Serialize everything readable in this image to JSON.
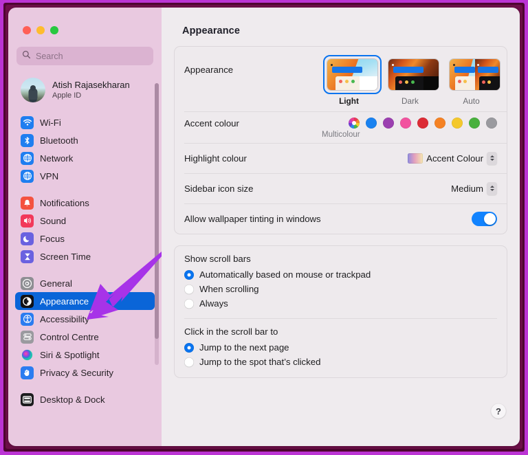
{
  "window": {
    "traffic_lights": [
      "close",
      "minimise",
      "maximise"
    ],
    "pane_title": "Appearance"
  },
  "sidebar": {
    "search": {
      "placeholder": "Search",
      "value": "",
      "icon": "search-icon"
    },
    "account": {
      "name": "Atish Rajasekharan",
      "subtitle": "Apple ID",
      "avatar": "user-avatar"
    },
    "groups": [
      {
        "items": [
          {
            "label": "Wi-Fi",
            "icon": "wifi-icon",
            "color": "#1f7ef0",
            "selected": false
          },
          {
            "label": "Bluetooth",
            "icon": "bluetooth-icon",
            "color": "#1f7ef0",
            "selected": false
          },
          {
            "label": "Network",
            "icon": "network-globe-icon",
            "color": "#1f7ef0",
            "selected": false
          },
          {
            "label": "VPN",
            "icon": "vpn-globe-icon",
            "color": "#1f7ef0",
            "selected": false
          }
        ]
      },
      {
        "items": [
          {
            "label": "Notifications",
            "icon": "bell-icon",
            "color": "#f4523f",
            "selected": false
          },
          {
            "label": "Sound",
            "icon": "speaker-icon",
            "color": "#f2385a",
            "selected": false
          },
          {
            "label": "Focus",
            "icon": "moon-icon",
            "color": "#6a61e0",
            "selected": false
          },
          {
            "label": "Screen Time",
            "icon": "hourglass-icon",
            "color": "#6a61e0",
            "selected": false
          }
        ]
      },
      {
        "items": [
          {
            "label": "General",
            "icon": "gear-icon",
            "color": "#8e8e93",
            "selected": false
          },
          {
            "label": "Appearance",
            "icon": "appearance-icon",
            "color": "#1c1c1e",
            "selected": true
          },
          {
            "label": "Accessibility",
            "icon": "accessibility-icon",
            "color": "#2b7cf0",
            "selected": false
          },
          {
            "label": "Control Centre",
            "icon": "control-centre-icon",
            "color": "#9a9a9f",
            "selected": false
          },
          {
            "label": "Siri & Spotlight",
            "icon": "siri-icon",
            "color": "#2c2340",
            "selected": false
          },
          {
            "label": "Privacy & Security",
            "icon": "hand-icon",
            "color": "#2b7cf0",
            "selected": false
          }
        ]
      },
      {
        "items": [
          {
            "label": "Desktop & Dock",
            "icon": "desktop-dock-icon",
            "color": "#1c1c1e",
            "selected": false
          }
        ]
      }
    ]
  },
  "main": {
    "appearance": {
      "label": "Appearance",
      "options": [
        {
          "name": "Light",
          "selected": true
        },
        {
          "name": "Dark",
          "selected": false
        },
        {
          "name": "Auto",
          "selected": false
        }
      ]
    },
    "accent_colour": {
      "label": "Accent colour",
      "caption": "Multicolour",
      "swatches": [
        {
          "name": "Multicolour",
          "hex": "multicolour",
          "selected": true
        },
        {
          "name": "Blue",
          "hex": "#1a82f0",
          "selected": false
        },
        {
          "name": "Purple",
          "hex": "#9b3fb0",
          "selected": false
        },
        {
          "name": "Pink",
          "hex": "#f2539f",
          "selected": false
        },
        {
          "name": "Red",
          "hex": "#dc2c36",
          "selected": false
        },
        {
          "name": "Orange",
          "hex": "#f58224",
          "selected": false
        },
        {
          "name": "Yellow",
          "hex": "#f4c82c",
          "selected": false
        },
        {
          "name": "Green",
          "hex": "#49b03e",
          "selected": false
        },
        {
          "name": "Graphite",
          "hex": "#9a9a9f",
          "selected": false
        }
      ]
    },
    "highlight_colour": {
      "label": "Highlight colour",
      "value": "Accent Colour"
    },
    "sidebar_icon_size": {
      "label": "Sidebar icon size",
      "value": "Medium"
    },
    "wallpaper_tinting": {
      "label": "Allow wallpaper tinting in windows",
      "enabled": true,
      "toggle_color": "#1283fe"
    },
    "scroll_bars": {
      "title": "Show scroll bars",
      "options": [
        {
          "label": "Automatically based on mouse or trackpad",
          "selected": true
        },
        {
          "label": "When scrolling",
          "selected": false
        },
        {
          "label": "Always",
          "selected": false
        }
      ]
    },
    "scroll_bar_click": {
      "title": "Click in the scroll bar to",
      "options": [
        {
          "label": "Jump to the next page",
          "selected": true
        },
        {
          "label": "Jump to the spot that’s clicked",
          "selected": false
        }
      ]
    },
    "help_button": {
      "label": "?",
      "icon": "question-mark-icon"
    }
  },
  "annotation": {
    "arrow_color": "#a733e8",
    "points_to": "Appearance"
  }
}
